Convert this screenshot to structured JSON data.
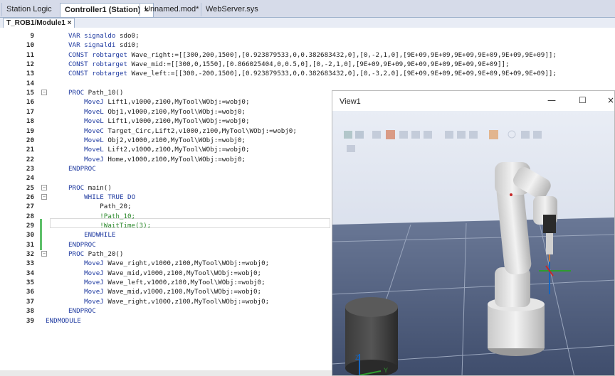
{
  "tabs": [
    {
      "label": "Station Logic",
      "active": false
    },
    {
      "label": "Controller1 (Station)",
      "active": true,
      "close": "×"
    },
    {
      "label": "Unnamed.mod*",
      "active": false
    },
    {
      "label": "WebServer.sys",
      "active": false
    }
  ],
  "subtab": {
    "label": "T_ROB1/Module1",
    "close": "×"
  },
  "lines": [
    {
      "n": "9",
      "text": "VAR signaldo sdo0;"
    },
    {
      "n": "10",
      "text": "VAR signaldi sdi0;"
    },
    {
      "n": "11",
      "text": "CONST robtarget Wave_right:=[[300,200,1500],[0.923879533,0,0.382683432,0],[0,-2,1,0],[9E+09,9E+09,9E+09,9E+09,9E+09,9E+09]];"
    },
    {
      "n": "12",
      "text": "CONST robtarget Wave_mid:=[[300,0,1550],[0.866025404,0,0.5,0],[0,-2,1,0],[9E+09,9E+09,9E+09,9E+09,9E+09,9E+09]];"
    },
    {
      "n": "13",
      "text": "CONST robtarget Wave_left:=[[300,-200,1500],[0.923879533,0,0.382683432,0],[0,-3,2,0],[9E+09,9E+09,9E+09,9E+09,9E+09,9E+09]];"
    },
    {
      "n": "14",
      "text": ""
    },
    {
      "n": "15",
      "text": "PROC Path_10()"
    },
    {
      "n": "16",
      "text": "    MoveJ Lift1,v1000,z100,MyTool\\WObj:=wobj0;"
    },
    {
      "n": "17",
      "text": "    MoveL Obj1,v1000,z100,MyTool\\WObj:=wobj0;"
    },
    {
      "n": "18",
      "text": "    MoveL Lift1,v1000,z100,MyTool\\WObj:=wobj0;"
    },
    {
      "n": "19",
      "text": "    MoveC Target_Circ,Lift2,v1000,z100,MyTool\\WObj:=wobj0;"
    },
    {
      "n": "20",
      "text": "    MoveL Obj2,v1000,z100,MyTool\\WObj:=wobj0;"
    },
    {
      "n": "21",
      "text": "    MoveL Lift2,v1000,z100,MyTool\\WObj:=wobj0;"
    },
    {
      "n": "22",
      "text": "    MoveJ Home,v1000,z100,MyTool\\WObj:=wobj0;"
    },
    {
      "n": "23",
      "text": "ENDPROC"
    },
    {
      "n": "24",
      "text": ""
    },
    {
      "n": "25",
      "text": "PROC main()"
    },
    {
      "n": "26",
      "text": "    WHILE TRUE DO"
    },
    {
      "n": "27",
      "text": "        Path_20;"
    },
    {
      "n": "28",
      "text": "        !Path_10;"
    },
    {
      "n": "29",
      "text": "        !WaitTime(3);"
    },
    {
      "n": "30",
      "text": "    ENDWHILE"
    },
    {
      "n": "31",
      "text": "ENDPROC"
    },
    {
      "n": "32",
      "text": "PROC Path_20()"
    },
    {
      "n": "33",
      "text": "    MoveJ Wave_right,v1000,z100,MyTool\\WObj:=wobj0;"
    },
    {
      "n": "34",
      "text": "    MoveJ Wave_mid,v1000,z100,MyTool\\WObj:=wobj0;"
    },
    {
      "n": "35",
      "text": "    MoveJ Wave_left,v1000,z100,MyTool\\WObj:=wobj0;"
    },
    {
      "n": "36",
      "text": "    MoveJ Wave_mid,v1000,z100,MyTool\\WObj:=wobj0;"
    },
    {
      "n": "37",
      "text": "    MoveJ Wave_right,v1000,z100,MyTool\\WObj:=wobj0;"
    },
    {
      "n": "38",
      "text": "ENDPROC"
    },
    {
      "n": "39",
      "text": "ENDMODULE"
    }
  ],
  "view": {
    "title": "View1",
    "minimize": "—",
    "maximize": "☐",
    "close": "×"
  },
  "axes": {
    "z": "Z",
    "y": "Y"
  },
  "colors": {
    "keyword": "#1f3aa0",
    "comment": "#2e8b2e",
    "floor": "#4a5a78",
    "grid": "#9aa6bd"
  }
}
